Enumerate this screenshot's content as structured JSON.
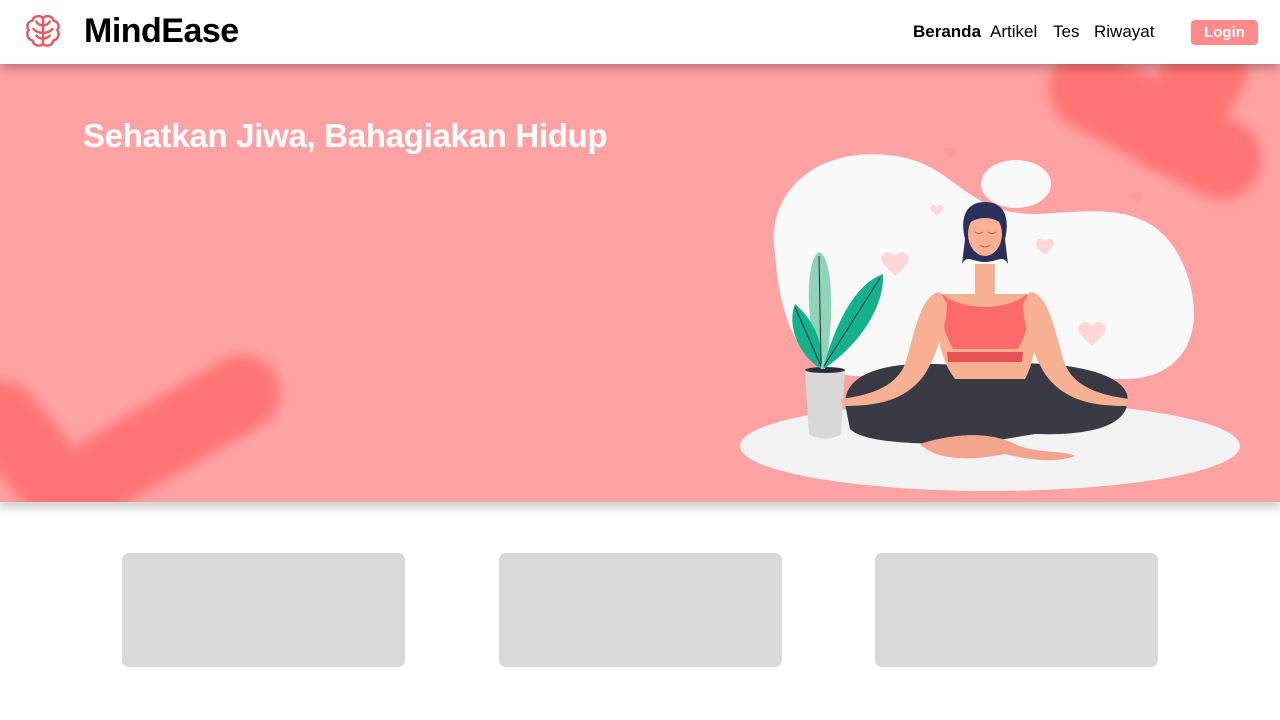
{
  "brand": {
    "name": "MindEase",
    "logo_icon": "brain-icon",
    "accent": "#e85a5f"
  },
  "nav": {
    "links": [
      {
        "label": "Beranda",
        "active": true
      },
      {
        "label": "Artikel",
        "active": false
      },
      {
        "label": "Tes",
        "active": false
      },
      {
        "label": "Riwayat",
        "active": false
      }
    ],
    "login_label": "Login",
    "login_color": "#ff8a8a"
  },
  "hero": {
    "title": "Sehatkan Jiwa, Bahagiakan Hidup",
    "background": "#ffa2a3",
    "illustration": "meditating-woman-illustration"
  },
  "cards": [
    {
      "kind": "placeholder-card"
    },
    {
      "kind": "placeholder-card"
    },
    {
      "kind": "placeholder-card"
    }
  ]
}
